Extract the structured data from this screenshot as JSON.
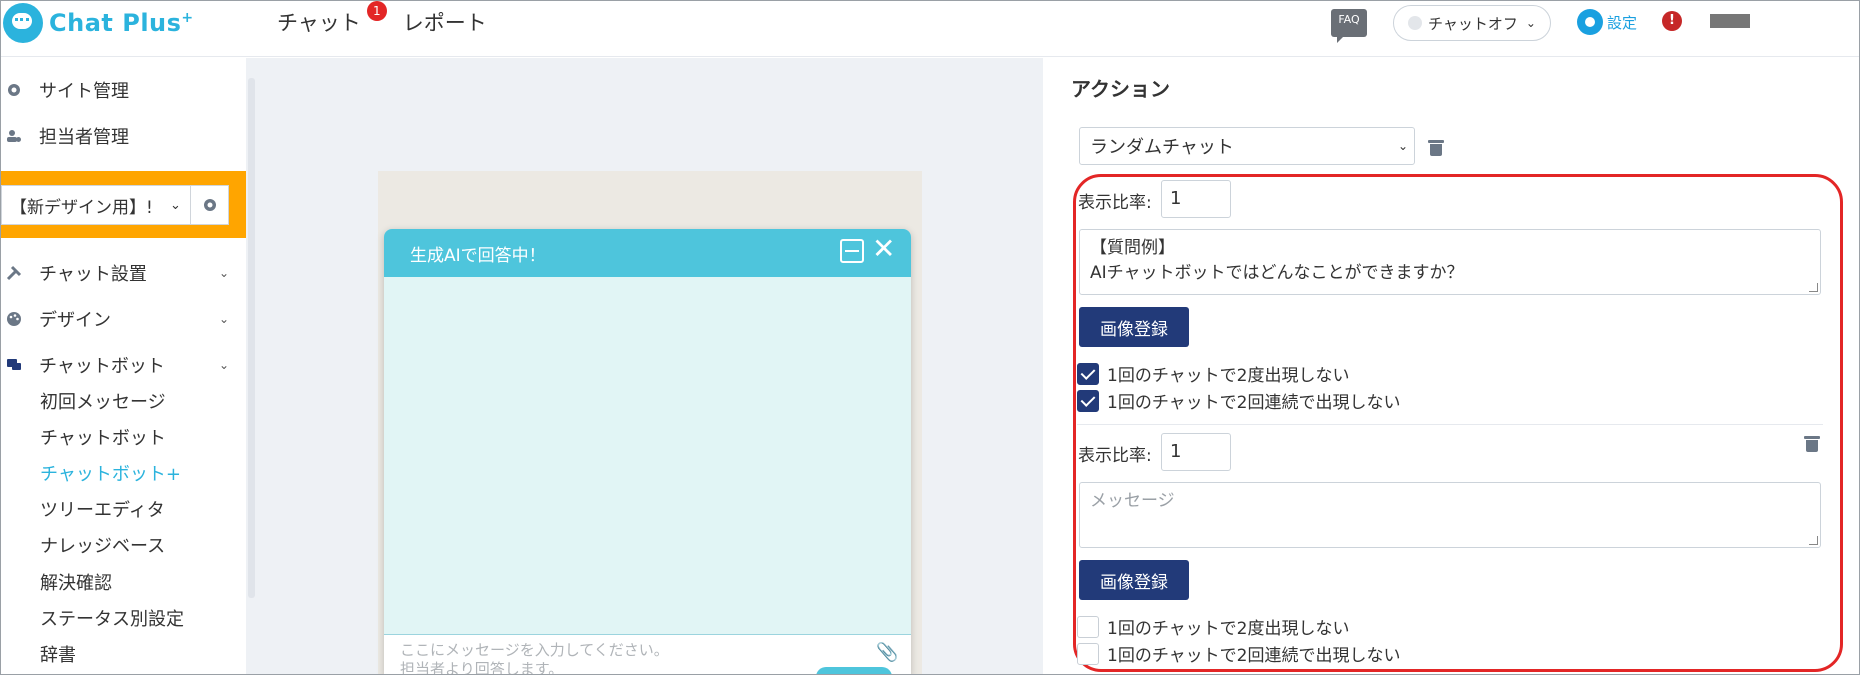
{
  "header": {
    "logo_text": "Chat Plus",
    "logo_plus": "+",
    "nav": [
      {
        "label": "チャット",
        "badge": "1"
      },
      {
        "label": "レポート"
      }
    ],
    "faq": "FAQ",
    "chat_status": "チャットオフ",
    "settings_label": "設定",
    "alert": "!"
  },
  "sidebar": {
    "top_items": [
      {
        "label": "サイト管理",
        "icon": "gear-icon"
      },
      {
        "label": "担当者管理",
        "icon": "user-gear-icon"
      }
    ],
    "site_select": "【新デザイン用】!",
    "groups": [
      {
        "label": "チャット設置",
        "icon": "tools-icon"
      },
      {
        "label": "デザイン",
        "icon": "palette-icon"
      },
      {
        "label": "チャットボット",
        "icon": "chat-bubbles-icon"
      }
    ],
    "sub_items": [
      {
        "label": "初回メッセージ",
        "active": false
      },
      {
        "label": "チャットボット",
        "active": false
      },
      {
        "label": "チャットボット+",
        "active": true
      },
      {
        "label": "ツリーエディタ",
        "active": false
      },
      {
        "label": "ナレッジベース",
        "active": false
      },
      {
        "label": "解決確認",
        "active": false
      },
      {
        "label": "ステータス別設定",
        "active": false
      },
      {
        "label": "辞書",
        "active": false
      }
    ]
  },
  "preview": {
    "title": "生成AIで回答中！",
    "input_line1": "ここにメッセージを入力してください。",
    "input_line2": "担当者より回答します。"
  },
  "action": {
    "section_title": "アクション",
    "select_value": "ランダムチャット",
    "ratio_label": "表示比率:",
    "entries": [
      {
        "ratio": "1",
        "message_line1": "【質問例】",
        "message_line2": "AIチャットボットではどんなことができますか？",
        "image_button": "画像登録",
        "options": [
          {
            "label": "1回のチャットで2度出現しない",
            "checked": true
          },
          {
            "label": "1回のチャットで2回連続で出現しない",
            "checked": true
          }
        ]
      },
      {
        "ratio": "1",
        "placeholder": "メッセージ",
        "image_button": "画像登録",
        "options": [
          {
            "label": "1回のチャットで2度出現しない",
            "checked": false
          },
          {
            "label": "1回のチャットで2回連続で出現しない",
            "checked": false
          }
        ]
      }
    ]
  },
  "colors": {
    "brand": "#2bb3dd",
    "accent_orange": "#ffa500",
    "primary_button": "#223a79",
    "highlight_red": "#e32626",
    "chat_header": "#4ec5dc"
  }
}
